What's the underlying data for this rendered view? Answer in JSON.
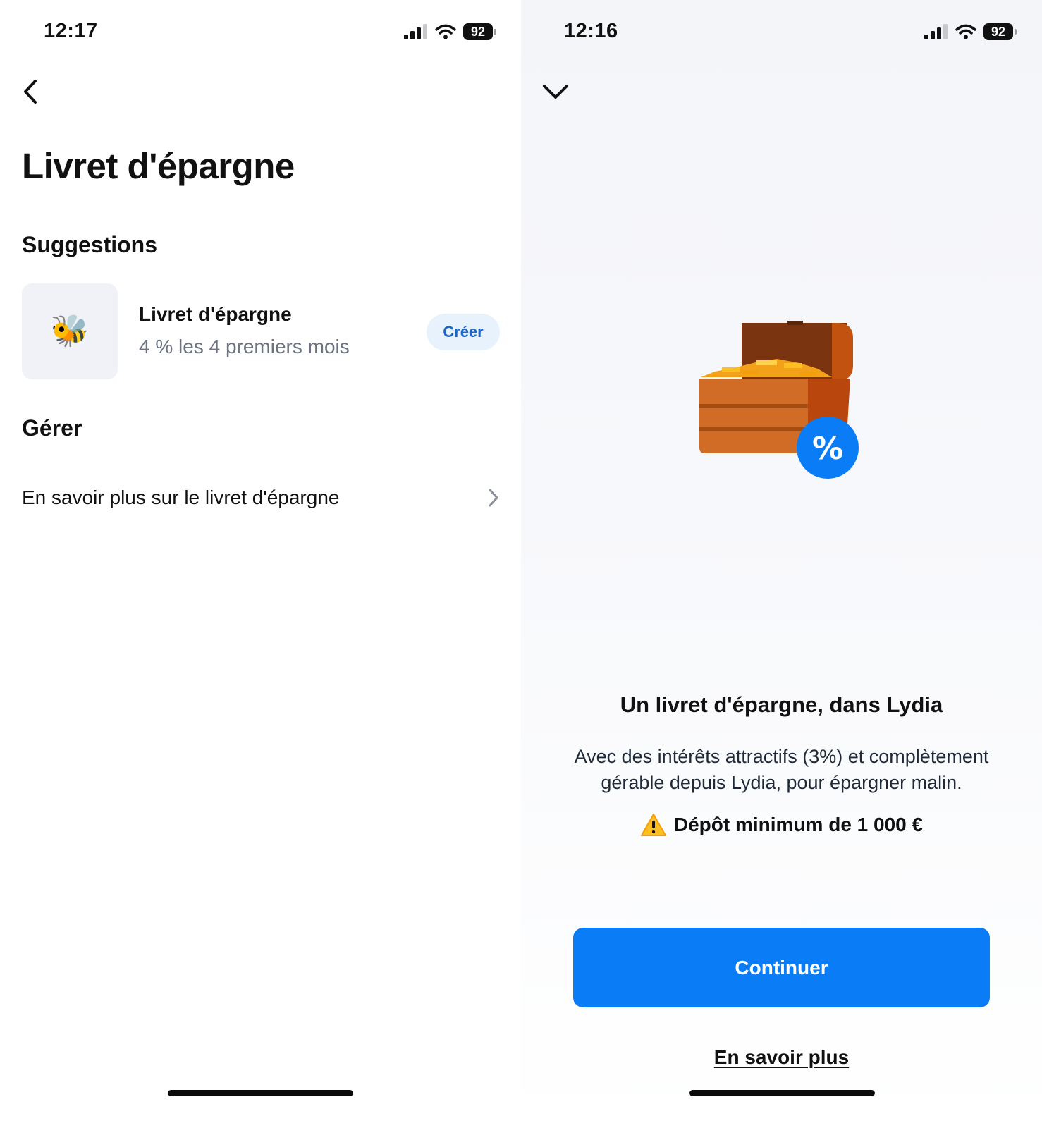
{
  "left_screen": {
    "status": {
      "time": "12:17",
      "battery": "92"
    },
    "title": "Livret d'épargne",
    "suggestions": {
      "heading": "Suggestions",
      "item": {
        "emoji": "🐝",
        "title": "Livret d'épargne",
        "subtitle": "4 % les 4 premiers mois",
        "button": "Créer"
      }
    },
    "manage": {
      "heading": "Gérer",
      "item_label": "En savoir plus sur le livret d'épargne"
    }
  },
  "right_screen": {
    "status": {
      "time": "12:16",
      "battery": "92"
    },
    "badge_symbol": "%",
    "heading": "Un livret d'épargne, dans Lydia",
    "description": "Avec des intérêts attractifs (3%) et complètement gérable depuis Lydia, pour épargner malin.",
    "warning": "Dépôt minimum de 1 000 €",
    "primary_button": "Continuer",
    "secondary_link": "En savoir plus"
  },
  "colors": {
    "accent": "#0a7cf5",
    "chip_bg": "#e8f2fd",
    "chip_text": "#1d64c8",
    "tile_bg": "#f0f2f7",
    "subtext": "#6b7280"
  },
  "icons": [
    "back-arrow-icon",
    "chevron-right-icon",
    "chevron-down-icon",
    "signal-icon",
    "wifi-icon",
    "battery-icon",
    "warning-icon",
    "treasure-chest-illustration"
  ]
}
